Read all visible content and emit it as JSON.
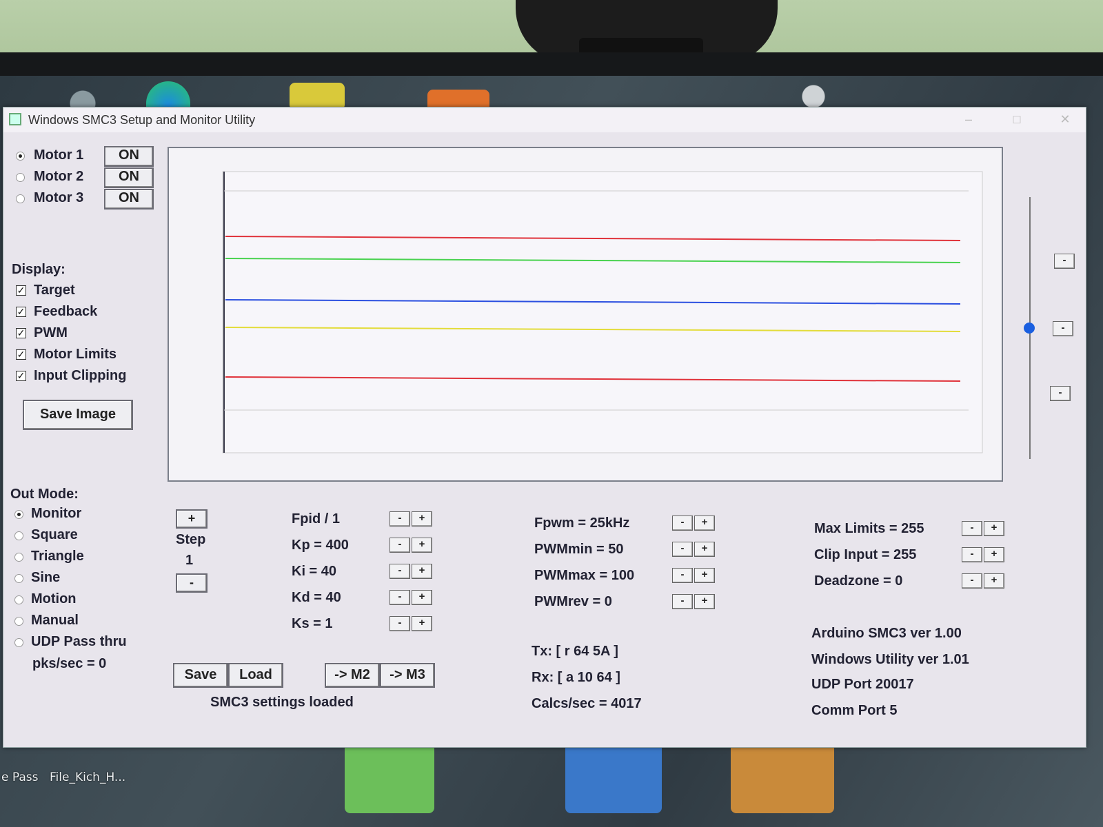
{
  "window": {
    "title": "Windows SMC3 Setup and Monitor Utility"
  },
  "motors": [
    {
      "label": "Motor 1",
      "button": "ON",
      "selected": true
    },
    {
      "label": "Motor 2",
      "button": "ON",
      "selected": false
    },
    {
      "label": "Motor 3",
      "button": "ON",
      "selected": false
    }
  ],
  "display": {
    "heading": "Display:",
    "options": [
      {
        "label": "Target",
        "checked": true
      },
      {
        "label": "Feedback",
        "checked": true
      },
      {
        "label": "PWM",
        "checked": true
      },
      {
        "label": "Motor Limits",
        "checked": true
      },
      {
        "label": "Input Clipping",
        "checked": true
      }
    ],
    "save_image": "Save Image"
  },
  "graph": {
    "line_colors": [
      "#e0323a",
      "#49d24f",
      "#2b4fe0",
      "#e3dc3a",
      "#e0323a"
    ],
    "levels": [
      0.78,
      0.7,
      0.55,
      0.45,
      0.27
    ]
  },
  "slider": {
    "minus_top": "-",
    "minus_mid": "-",
    "minus_bottom": "-"
  },
  "out_mode": {
    "heading": "Out Mode:",
    "options": [
      {
        "label": "Monitor",
        "selected": true
      },
      {
        "label": "Square",
        "selected": false
      },
      {
        "label": "Triangle",
        "selected": false
      },
      {
        "label": "Sine",
        "selected": false
      },
      {
        "label": "Motion",
        "selected": false
      },
      {
        "label": "Manual",
        "selected": false
      },
      {
        "label": "UDP Pass thru",
        "selected": false
      }
    ],
    "pks": "pks/sec = 0"
  },
  "step": {
    "plus": "+",
    "label": "Step",
    "value": "1",
    "minus": "-"
  },
  "pid": [
    {
      "label": "Fpid / 1"
    },
    {
      "label": "Kp = 400"
    },
    {
      "label": "Ki = 40"
    },
    {
      "label": "Kd = 40"
    },
    {
      "label": "Ks = 1"
    }
  ],
  "pwm": [
    {
      "label": "Fpwm = 25kHz"
    },
    {
      "label": "PWMmin = 50"
    },
    {
      "label": "PWMmax = 100"
    },
    {
      "label": "PWMrev = 0"
    }
  ],
  "limits": [
    {
      "label": "Max Limits = 255"
    },
    {
      "label": "Clip Input = 255"
    },
    {
      "label": "Deadzone = 0"
    }
  ],
  "pm": {
    "minus": "-",
    "plus": "+"
  },
  "buttons": {
    "save": "Save",
    "load": "Load",
    "to_m2": "-> M2",
    "to_m3": "-> M3"
  },
  "status": "SMC3 settings loaded",
  "comms": {
    "tx": "Tx: [ r 64 5A ]",
    "rx": "Rx: [ a 10 64 ]",
    "calcs": "Calcs/sec = 4017"
  },
  "info": {
    "arduino": "Arduino SMC3 ver 1.00",
    "utility": "Windows Utility ver 1.01",
    "udp": "UDP Port 20017",
    "comm": "Comm Port 5"
  },
  "taskbar": {
    "item1": "e Pass",
    "item2": "File_Kich_H..."
  }
}
